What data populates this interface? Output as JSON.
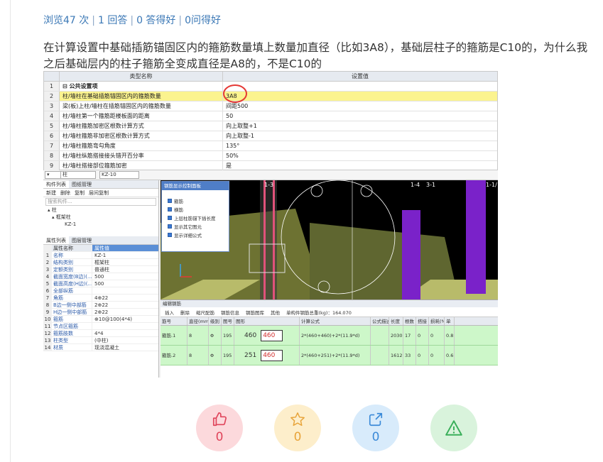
{
  "stats": {
    "views": "浏览47 次",
    "answers": "1 回答",
    "good_answers": "0 答得好",
    "asked_good": "0问得好"
  },
  "question": {
    "line1": "在计算设置中基础插筋锚固区内的箍筋数量填上数量加直径（比如3A8），基础层柱子的箍筋是C10的，为什么我",
    "line2": "之后基础层内的柱子箍筋全变成直径是A8的，不是C10的"
  },
  "screenshot": {
    "grid_headers": {
      "name": "类型名称",
      "value": "设置值"
    },
    "grid_rows": [
      {
        "n": "1",
        "k": "⊟ 公共设置项",
        "v": ""
      },
      {
        "n": "2",
        "k": "柱/墙柱在基础插筋锚固区内的箍筋数量",
        "v": "3A8"
      },
      {
        "n": "3",
        "k": "梁(板)上柱/墙柱在插筋锚固区内的箍筋数量",
        "v": "间距500"
      },
      {
        "n": "4",
        "k": "柱/墙柱第一个箍筋距楼板面的距离",
        "v": "50"
      },
      {
        "n": "5",
        "k": "柱/墙柱箍筋加密区根数计算方式",
        "v": "向上取整+1"
      },
      {
        "n": "6",
        "k": "柱/墙柱箍筋非加密区根数计算方式",
        "v": "向上取整-1"
      },
      {
        "n": "7",
        "k": "柱/墙柱箍筋弯勾角度",
        "v": "135°"
      },
      {
        "n": "8",
        "k": "柱/墙柱纵筋搭接接头错开百分率",
        "v": "50%"
      },
      {
        "n": "9",
        "k": "柱/墙柱搭接部位箍筋加密",
        "v": "是"
      }
    ],
    "ctl": {
      "type": "柱",
      "id": "KZ-10"
    },
    "left_tabs": [
      "构件列表",
      "图纸管理"
    ],
    "left_tools": [
      "新建",
      "删除",
      "复制",
      "层间复制"
    ],
    "search_placeholder": "搜索构件...",
    "tree": [
      "▴ 柱",
      "▴ 框架柱",
      "KZ-1"
    ],
    "prop_tabs": [
      "属性列表",
      "图层管理"
    ],
    "prop_head": {
      "name": "属性名称",
      "value": "属性值"
    },
    "props": [
      {
        "n": "1",
        "k": "名称",
        "v": "KZ-1"
      },
      {
        "n": "2",
        "k": "结构类别",
        "v": "框架柱"
      },
      {
        "n": "3",
        "k": "定额类别",
        "v": "普通柱"
      },
      {
        "n": "4",
        "k": "截面宽度(B边)(...",
        "v": "500"
      },
      {
        "n": "5",
        "k": "截面高度(H边)(...",
        "v": "500"
      },
      {
        "n": "6",
        "k": "全部纵筋",
        "v": ""
      },
      {
        "n": "7",
        "k": "角筋",
        "v": "4⊕22"
      },
      {
        "n": "8",
        "k": "B边一侧中部筋",
        "v": "2⊕22"
      },
      {
        "n": "9",
        "k": "H边一侧中部筋",
        "v": "2⊕22"
      },
      {
        "n": "10",
        "k": "箍筋",
        "v": "⊕10@100(4*4)"
      },
      {
        "n": "11",
        "k": "节点区箍筋",
        "v": ""
      },
      {
        "n": "12",
        "k": "箍筋肢数",
        "v": "4*4"
      },
      {
        "n": "13",
        "k": "柱类型",
        "v": "(中柱)"
      },
      {
        "n": "14",
        "k": "材质",
        "v": "现浇混凝土"
      }
    ],
    "dialog": {
      "title": "钢筋显示控制面板",
      "options": [
        "箍筋",
        "横筋",
        "上层柱筋锚下插长度",
        "显示其它图元",
        "显示详细公式"
      ]
    },
    "axis_labels": [
      "1-3",
      "1-4",
      "3-1",
      "1-1/"
    ],
    "rebar_panel": {
      "title": "编辑钢筋",
      "tools": [
        "插入",
        "删除",
        "缩尺配筋",
        "钢筋信息",
        "钢筋图库",
        "其他",
        "单构件钢筋总重(kg)：164.070"
      ],
      "headers": [
        "筋号",
        "直径(mm)",
        "级别",
        "图号",
        "图形",
        "计算公式",
        "公式描述",
        "长度",
        "根数",
        "搭接",
        "损耗(%)",
        "单"
      ],
      "rows": [
        {
          "name": "箍筋.1",
          "dia": "8",
          "grade": "Φ",
          "fig": "195",
          "shape_a": "460",
          "shape_b": "460",
          "formula": "2*(460+460)+2*(11.9*d)",
          "len": "2030",
          "count": "17",
          "lap": "0",
          "loss": "0",
          "unit": "0.8"
        },
        {
          "name": "箍筋.2",
          "dia": "8",
          "grade": "Φ",
          "fig": "195",
          "shape_a": "251",
          "shape_b": "460",
          "formula": "2*(460+251)+2*(11.9*d)",
          "len": "1612",
          "count": "33",
          "lap": "0",
          "loss": "0",
          "unit": "0.6"
        }
      ]
    }
  },
  "actions": {
    "like_count": "0",
    "fav_count": "0",
    "share_count": "0"
  },
  "colors": {
    "link": "#3b78b6",
    "highlight": "#fbf38f",
    "rebar_row": "#cdf7c9",
    "like": "#e0455b",
    "fav": "#e8a43a",
    "share": "#3b8ad8",
    "report": "#3aaf5a"
  }
}
